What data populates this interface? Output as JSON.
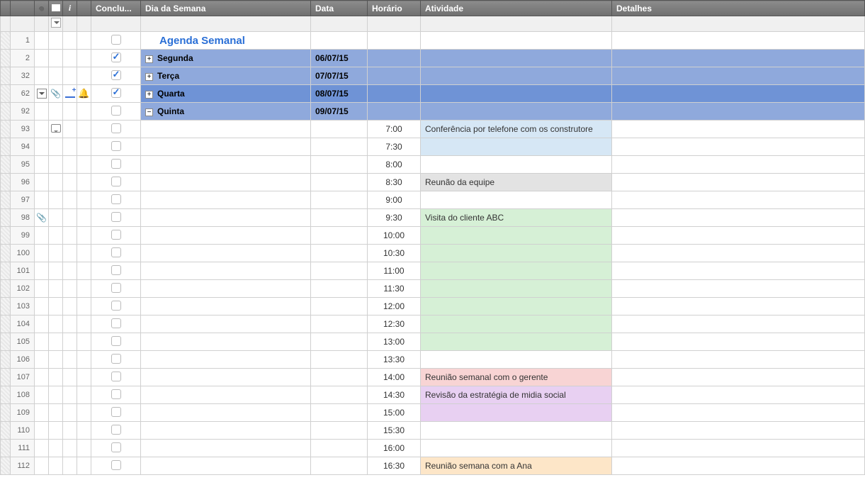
{
  "columns": {
    "attach": "",
    "comment": "",
    "info": "i",
    "conclu": "Conclu...",
    "dia": "Dia da Semana",
    "data": "Data",
    "horario": "Horário",
    "atividade": "Atividade",
    "detalhes": "Detalhes"
  },
  "title": "Agenda Semanal",
  "days": [
    {
      "num": 2,
      "label": "Segunda",
      "date": "06/07/15",
      "checked": true,
      "expand": "+",
      "selected": false
    },
    {
      "num": 32,
      "label": "Terça",
      "date": "07/07/15",
      "checked": true,
      "expand": "+",
      "selected": false
    },
    {
      "num": 62,
      "label": "Quarta",
      "date": "08/07/15",
      "checked": true,
      "expand": "+",
      "selected": true,
      "active_row": true
    },
    {
      "num": 92,
      "label": "Quinta",
      "date": "09/07/15",
      "checked": false,
      "expand": "−",
      "selected": false
    }
  ],
  "slots": [
    {
      "num": 93,
      "time": "7:00",
      "activity": "Conferência por telefone com os construtore",
      "color": "c-blue",
      "comment": true
    },
    {
      "num": 94,
      "time": "7:30",
      "activity": "",
      "color": "c-blue"
    },
    {
      "num": 95,
      "time": "8:00",
      "activity": "",
      "color": ""
    },
    {
      "num": 96,
      "time": "8:30",
      "activity": "Reunão da equipe",
      "color": "c-grey"
    },
    {
      "num": 97,
      "time": "9:00",
      "activity": "",
      "color": ""
    },
    {
      "num": 98,
      "time": "9:30",
      "activity": "Visita do cliente ABC",
      "color": "c-green",
      "attach": true
    },
    {
      "num": 99,
      "time": "10:00",
      "activity": "",
      "color": "c-green"
    },
    {
      "num": 100,
      "time": "10:30",
      "activity": "",
      "color": "c-green"
    },
    {
      "num": 101,
      "time": "11:00",
      "activity": "",
      "color": "c-green"
    },
    {
      "num": 102,
      "time": "11:30",
      "activity": "",
      "color": "c-green"
    },
    {
      "num": 103,
      "time": "12:00",
      "activity": "",
      "color": "c-green"
    },
    {
      "num": 104,
      "time": "12:30",
      "activity": "",
      "color": "c-green"
    },
    {
      "num": 105,
      "time": "13:00",
      "activity": "",
      "color": "c-green"
    },
    {
      "num": 106,
      "time": "13:30",
      "activity": "",
      "color": ""
    },
    {
      "num": 107,
      "time": "14:00",
      "activity": "Reunião semanal com o gerente",
      "color": "c-pink"
    },
    {
      "num": 108,
      "time": "14:30",
      "activity": "Revisão da estratégia de midia social",
      "color": "c-purple"
    },
    {
      "num": 109,
      "time": "15:00",
      "activity": "",
      "color": "c-purple"
    },
    {
      "num": 110,
      "time": "15:30",
      "activity": "",
      "color": ""
    },
    {
      "num": 111,
      "time": "16:00",
      "activity": "",
      "color": ""
    },
    {
      "num": 112,
      "time": "16:30",
      "activity": "Reunião semana com a Ana",
      "color": "c-orange"
    }
  ]
}
